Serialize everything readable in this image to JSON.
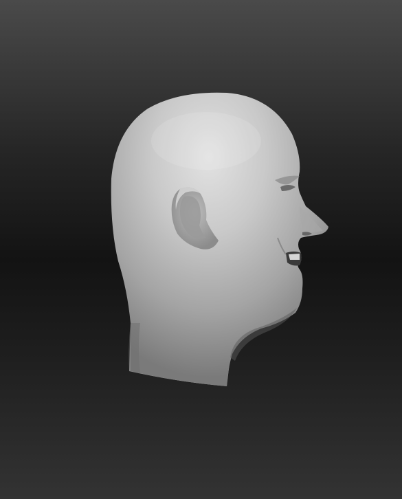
{
  "viewport": {
    "background_top": "#4a4a4a",
    "background_mid": "#131313",
    "background_bottom": "#333333"
  },
  "model": {
    "name": "sculpted-head-profile",
    "material_color": "#c8c8c8",
    "facing": "right"
  }
}
